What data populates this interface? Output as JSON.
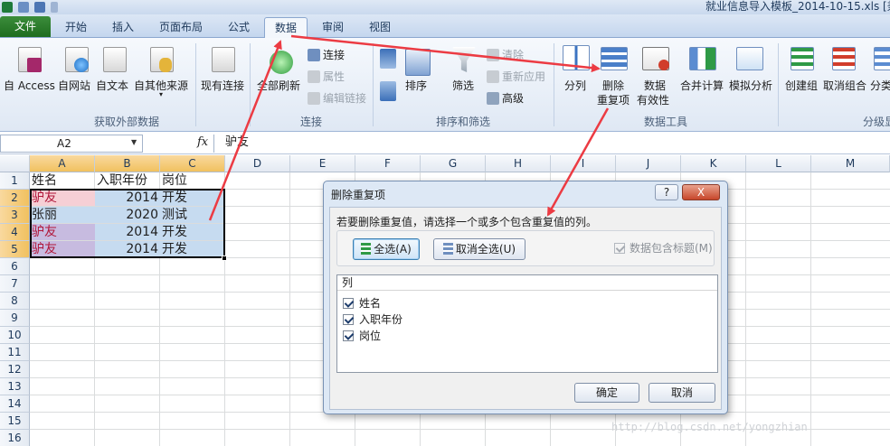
{
  "window": {
    "title": "就业信息导入模板_2014-10-15.xls  [兼"
  },
  "tabs": [
    "文件",
    "开始",
    "插入",
    "页面布局",
    "公式",
    "数据",
    "审阅",
    "视图"
  ],
  "active_tab": "数据",
  "ribbon": {
    "get_external": {
      "access": "自 Access",
      "web": "自网站",
      "text": "自文本",
      "other": "自其他来源",
      "existing": "现有连接",
      "group_label": "获取外部数据"
    },
    "connections": {
      "refresh_all": "全部刷新",
      "connections": "连接",
      "properties": "属性",
      "edit_links": "编辑链接",
      "group_label": "连接"
    },
    "sort_filter": {
      "sort": "排序",
      "filter": "筛选",
      "clear": "清除",
      "reapply": "重新应用",
      "advanced": "高级",
      "group_label": "排序和筛选"
    },
    "data_tools": {
      "text_to_columns": "分列",
      "remove_dup_line1": "删除",
      "remove_dup_line2": "重复项",
      "validation_line1": "数据",
      "validation_line2": "有效性",
      "consolidate": "合并计算",
      "what_if": "模拟分析",
      "group_label": "数据工具"
    },
    "outline": {
      "group": "创建组",
      "ungroup": "取消组合",
      "subtotal": "分类",
      "group_label": "分级显"
    },
    "colors": {
      "accent": "#1f6d1f",
      "tab_bg": "#c4d6ee",
      "ribbon_bg": "#dfe8f4"
    }
  },
  "formula_bar": {
    "name_box": "A2",
    "fx": "fx",
    "content": "驴友"
  },
  "grid": {
    "columns": [
      "A",
      "B",
      "C",
      "D",
      "E",
      "F",
      "G",
      "H",
      "I",
      "J",
      "K",
      "L",
      "M"
    ],
    "rows": [
      "1",
      "2",
      "3",
      "4",
      "5",
      "6",
      "7",
      "8",
      "9",
      "10",
      "11",
      "12",
      "13",
      "14",
      "15",
      "16"
    ],
    "data": [
      [
        "姓名",
        "入职年份",
        "岗位"
      ],
      [
        "驴友",
        "2014",
        "开发"
      ],
      [
        "张丽",
        "2020",
        "测试"
      ],
      [
        "驴友",
        "2014",
        "开发"
      ],
      [
        "驴友",
        "2014",
        "开发"
      ]
    ]
  },
  "dialog": {
    "title": "删除重复项",
    "help": "?",
    "close": "X",
    "instruction": "若要删除重复值，请选择一个或多个包含重复值的列。",
    "select_all": "全选(A)",
    "unselect_all": "取消全选(U)",
    "header_checkbox": "数据包含标题(M)",
    "list_header": "列",
    "columns": [
      "姓名",
      "入职年份",
      "岗位"
    ],
    "ok": "确定",
    "cancel": "取消"
  },
  "watermark": "http://blog.csdn.net/yongzhian"
}
